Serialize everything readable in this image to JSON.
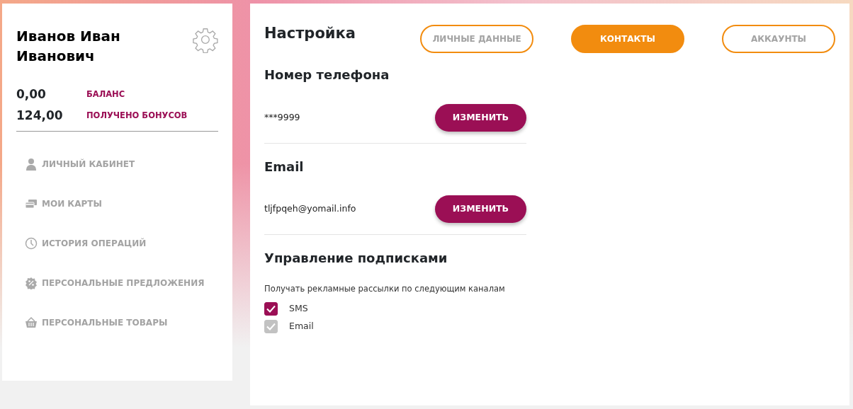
{
  "profile": {
    "name": "Иванов Иван Иванович",
    "stats": [
      {
        "value": "0,00",
        "label": "БАЛАНС"
      },
      {
        "value": "124,00",
        "label": "ПОЛУЧЕНО БОНУСОВ"
      }
    ]
  },
  "sidebar": {
    "items": [
      {
        "kind": "user",
        "label": "ЛИЧНЫЙ КАБИНЕТ"
      },
      {
        "kind": "cards",
        "label": "МОИ КАРТЫ"
      },
      {
        "kind": "clock",
        "label": "ИСТОРИЯ ОПЕРАЦИЙ"
      },
      {
        "kind": "percent",
        "label": "ПЕРСОНАЛЬНЫЕ ПРЕДЛОЖЕНИЯ"
      },
      {
        "kind": "basket",
        "label": "ПЕРСОНАЛЬНЫЕ ТОВАРЫ"
      }
    ]
  },
  "settings": {
    "title": "Настройка",
    "tabs": [
      {
        "label": "ЛИЧНЫЕ ДАННЫЕ",
        "selected": false
      },
      {
        "label": "КОНТАКТЫ",
        "selected": true
      },
      {
        "label": "АККАУНТЫ",
        "selected": false
      }
    ],
    "contacts": [
      {
        "heading": "Номер телефона",
        "value": "***9999",
        "button": "ИЗМЕНИТЬ"
      },
      {
        "heading": "Email",
        "value": "tljfpqeh@yomail.info",
        "button": "ИЗМЕНИТЬ"
      }
    ],
    "subscriptions": {
      "heading": "Управление подписками",
      "description": "Получать рекламные рассылки по следующим каналам",
      "channels": [
        {
          "label": "SMS",
          "checked": true,
          "disabled": false
        },
        {
          "label": "Email",
          "checked": true,
          "disabled": true
        }
      ]
    }
  }
}
